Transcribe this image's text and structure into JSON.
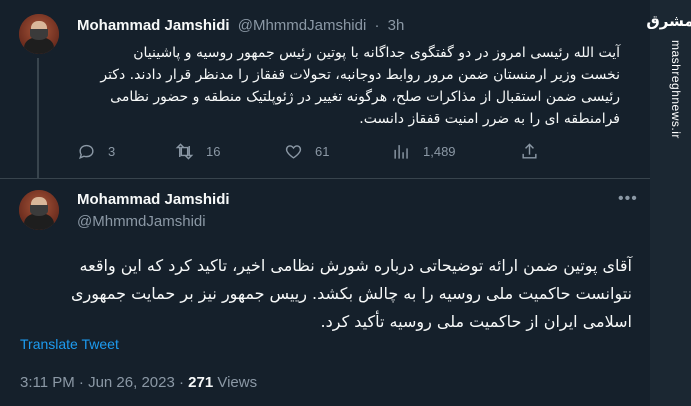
{
  "tweet1": {
    "name": "Mohammad Jamshidi",
    "handle": "@MhmmdJamshidi",
    "separator": "·",
    "time": "3h",
    "text": "آیت الله رئیسی امروز در دو گفتگوی جداگانه با پوتین رئیس جمهور روسیه و پاشینیان نخست وزیر ارمنستان  ضمن مرور روابط دوجانبه، تحولات قفقاز را مدنظر قرار دادند. دکتر رئیسی ضمن استقبال از مذاکرات صلح، هرگونه تغییر در ژئوپلتیک منطقه و حضور نظامی فرامنطقه ای را به ضرر امنیت قفقاز دانست.",
    "actions": {
      "reply_count": "3",
      "retweet_count": "16",
      "like_count": "61",
      "views_count": "1,489"
    }
  },
  "tweet2": {
    "name": "Mohammad Jamshidi",
    "handle": "@MhmmdJamshidi",
    "more_icon": "more-icon",
    "text": "آقای پوتین ضمن ارائه توضیحاتی درباره شورش نظامی اخیر، تاکید کرد که این واقعه نتوانست حاکمیت ملی روسیه را به چالش بکشد. رییس جمهور نیز بر حمایت جمهوری اسلامی ایران از حاکمیت ملی روسیه تأکید کرد.",
    "translate_label": "Translate Tweet",
    "timestamp": "3:11 PM · Jun 26, 2023 · ",
    "views_number": "271",
    "views_label": " Views"
  },
  "watermark": {
    "logo_text": "مشرق",
    "site": "mashreghnews.ir"
  },
  "colors": {
    "background": "#15202b",
    "text": "#f7f9f9",
    "secondary": "#8b98a5",
    "link": "#1d9bf0",
    "divider": "#38444d"
  },
  "icons": [
    "reply-icon",
    "retweet-icon",
    "like-icon",
    "views-icon",
    "share-icon",
    "more-icon"
  ]
}
